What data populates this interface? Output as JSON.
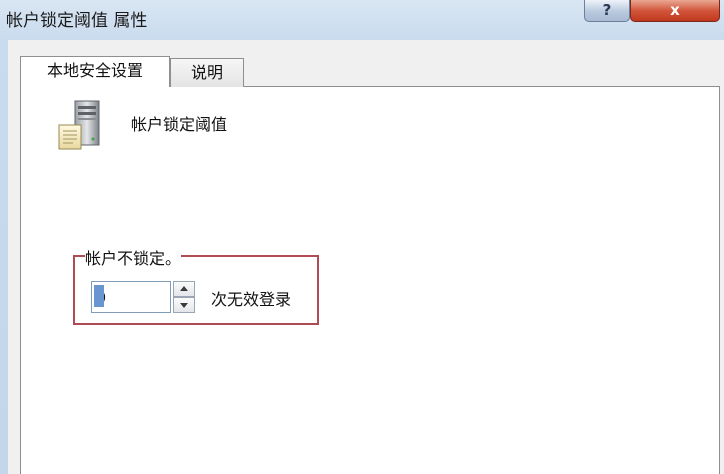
{
  "window": {
    "title": "帐户锁定阈值 属性",
    "help_label": "?",
    "close_label": "x"
  },
  "tabs": [
    {
      "label": "本地安全设置",
      "active": true
    },
    {
      "label": "说明",
      "active": false
    }
  ],
  "policy": {
    "icon": "server-icon",
    "name": "帐户锁定阈值"
  },
  "threshold": {
    "group_label": "帐户不锁定。",
    "value": "0",
    "unit": "次无效登录"
  },
  "colors": {
    "highlight_box": "#b04a55",
    "close_button": "#c9472c"
  }
}
